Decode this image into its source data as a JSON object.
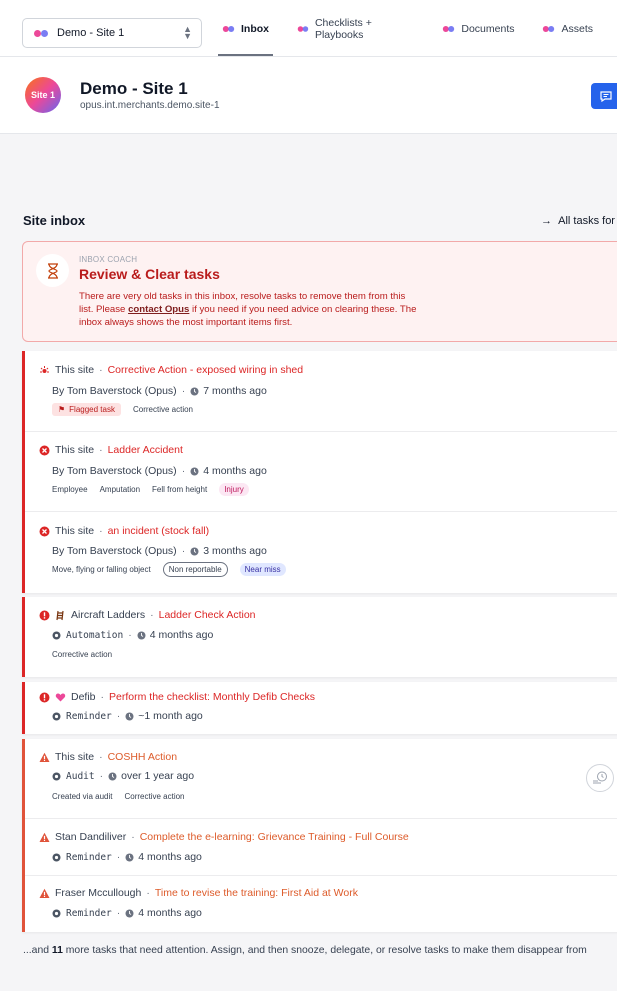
{
  "topbar": {
    "site_select": "Demo - Site 1",
    "tabs": [
      {
        "label": "Inbox",
        "active": true
      },
      {
        "label": "Checklists + Playbooks",
        "active": false
      },
      {
        "label": "Documents",
        "active": false
      },
      {
        "label": "Assets",
        "active": false
      }
    ]
  },
  "header": {
    "avatar_text": "Site 1",
    "site_name": "Demo - Site 1",
    "site_id": "opus.int.merchants.demo.site-1"
  },
  "inbox": {
    "title": "Site inbox",
    "all_tasks_link": "All tasks for"
  },
  "coach": {
    "label": "INBOX COACH",
    "title": "Review & Clear tasks",
    "text_before": "There are very old tasks in this inbox, resolve tasks to remove them from this list. Please",
    "link": "contact Opus",
    "text_after": "if you need if you need advice on clearing these. The inbox always shows the most important items first."
  },
  "tasks": [
    {
      "icon": "hazard-icon",
      "context": "This site",
      "title": "Corrective Action - exposed wiring in shed",
      "by_icon": "",
      "by": "By Tom Baverstock (Opus)",
      "age": "7 months ago",
      "tags": [
        "Flagged task",
        "Corrective action"
      ]
    },
    {
      "icon": "error-circle-icon",
      "context": "This site",
      "title": "Ladder Accident",
      "by_icon": "",
      "by": "By Tom Baverstock (Opus)",
      "age": "4 months ago",
      "tags": [
        "Employee",
        "Amputation",
        "Fell from height",
        "Injury"
      ]
    },
    {
      "icon": "error-circle-icon",
      "context": "This site",
      "title": "an incident (stock fall)",
      "by_icon": "",
      "by": "By Tom Baverstock (Opus)",
      "age": "3 months ago",
      "tags": [
        "Move, flying or falling object",
        "Non reportable",
        "Near miss"
      ]
    },
    {
      "icon": "alert-circle-icon",
      "context": "Aircraft Ladders",
      "title": "Ladder Check Action",
      "by_icon": "automation-icon",
      "by": "Automation",
      "age": "4 months ago",
      "tags": [
        "Corrective action"
      ]
    },
    {
      "icon": "alert-circle-icon",
      "context": "Defib",
      "title": "Perform the checklist: Monthly Defib Checks",
      "by_icon": "reminder-icon",
      "by": "Reminder",
      "age": "~1 month ago",
      "tags": []
    },
    {
      "icon": "warning-triangle-icon",
      "context": "This site",
      "title": "COSHH Action",
      "by_icon": "audit-icon",
      "by": "Audit",
      "age": "over 1 year ago",
      "tags": [
        "Created via audit",
        "Corrective action"
      ]
    },
    {
      "icon": "warning-triangle-icon",
      "context": "Stan Dandiliver",
      "title": "Complete the e-learning: Grievance Training - Full Course",
      "by_icon": "reminder-icon",
      "by": "Reminder",
      "age": "4 months ago",
      "tags": []
    },
    {
      "icon": "warning-triangle-icon",
      "context": "Fraser Mccullough",
      "title": "Time to revise the training: First Aid at Work",
      "by_icon": "reminder-icon",
      "by": "Reminder",
      "age": "4 months ago",
      "tags": []
    }
  ],
  "footer": {
    "prefix": "...and",
    "count": "11",
    "suffix": "more tasks that need attention. Assign, and then snooze, delegate, or resolve tasks to make them disappear from"
  },
  "colors": {
    "accent_red": "#dc2626",
    "accent_orange": "#dd5b2a",
    "brand_blue": "#2563eb"
  }
}
